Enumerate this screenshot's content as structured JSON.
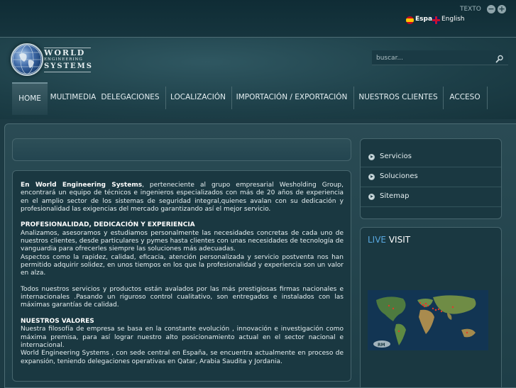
{
  "topbar": {
    "text_size_label": "TEXTO",
    "zoom_out_symbol": "−",
    "zoom_in_symbol": "+",
    "languages": [
      {
        "label": "Espa",
        "flag": "spain-flag-icon"
      },
      {
        "label": "English",
        "flag": "uk-flag-icon"
      }
    ]
  },
  "logo": {
    "line1": "WORLD",
    "line2": "ENGINEERING",
    "line3": "SYSTEMS"
  },
  "search": {
    "placeholder": "buscar..."
  },
  "nav": {
    "items": [
      {
        "label": "HOME",
        "active": true
      },
      {
        "label": "MULTIMEDIA"
      },
      {
        "label": "DELEGACIONES"
      },
      {
        "label": "LOCALIZACIÓN"
      },
      {
        "label": "IMPORTACIÓN / EXPORTACIÓN"
      },
      {
        "label": "NUESTROS CLIENTES"
      },
      {
        "label": "ACCESO"
      }
    ]
  },
  "content": {
    "intro_bold": "En World Engineering Systems",
    "intro_text": ", perteneciente al grupo  empresarial Wesholding Group, encontrará un equipo de técnicos e ingenieros especializados con más de 20 años de experiencia en el amplio sector de los sistemas de seguridad integral,quienes avalan con su dedicación y profesionalidad las exigencias del mercado garantizando así el mejor servicio.",
    "section1_heading": "PROFESIONALIDAD, DEDICACIÓN Y EXPERIENCIA",
    "section1_text1": "Analizamos, asesoramos y estudiamos personalmente las necesidades concretas de cada uno de nuestros clientes, desde particulares y pymes hasta clientes con unas necesidades de tecnología de vanguardia para ofrecerles siempre las soluciones más adecuadas.",
    "section1_text2": "Aspectos como la rapidez, calidad, eficacia, atención personalizada y servicio postventa nos han permitido adquirir solidez, en unos tiempos en los que la profesionalidad y experiencia son un valor en alza.",
    "section2_text": "Todos nuestros servicios y productos están avalados por las más prestigiosas firmas nacionales e internacionales .Pasando un riguroso control cualitativo, son entregados e instalados con las máximas garantías de calidad.",
    "section3_heading": "NUESTROS VALORES",
    "section3_text1": "Nuestra filosofía de empresa se basa en la constante evolución , innovación e investigación como máxima premisa, para así lograr nuestro alto posicionamiento actual en el sector nacional e internacional.",
    "section3_text2": "World Engineering Systems , con sede central en España, se encuentra actualmente en proceso de expansión, teniendo delegaciones operativas en Qatar, Arabia Saudita y Jordania."
  },
  "sidebar": {
    "items": [
      {
        "label": "Servicios"
      },
      {
        "label": "Soluciones"
      },
      {
        "label": "Sitemap"
      }
    ]
  },
  "live_visit": {
    "live_word": "LIVE",
    "visit_word": "VISIT",
    "map_logo": "RM"
  },
  "colors": {
    "background": "#1d3b44",
    "accent_blue": "#58a8e0",
    "visitor_dot": "#e03a2a"
  }
}
